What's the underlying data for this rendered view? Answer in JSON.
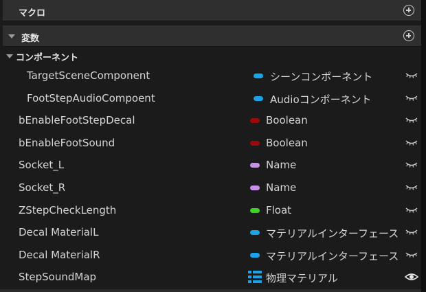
{
  "sections": {
    "macro_label": "マクロ",
    "variables_label": "変数"
  },
  "category": {
    "label": "コンポーネント"
  },
  "colors": {
    "object_blue": "#1aa3e8",
    "boolean_red": "#9b0a0a",
    "name_purple": "#c890ec",
    "float_green": "#3ed320"
  },
  "variables": [
    {
      "name": "TargetSceneComponent",
      "type": "シーンコンポーネント",
      "color": "#1aa3e8",
      "indent": true,
      "visibility": "closed-eye-icon"
    },
    {
      "name": "FootStepAudioCompoent",
      "type": "Audioコンポーネント",
      "color": "#1aa3e8",
      "indent": true,
      "visibility": "closed-eye-icon"
    },
    {
      "name": "bEnableFootStepDecal",
      "type": "Boolean",
      "color": "#9b0a0a",
      "indent": false,
      "visibility": "closed-eye-icon"
    },
    {
      "name": "bEnableFootSound",
      "type": "Boolean",
      "color": "#9b0a0a",
      "indent": false,
      "visibility": "closed-eye-icon"
    },
    {
      "name": "Socket_L",
      "type": "Name",
      "color": "#c890ec",
      "indent": false,
      "visibility": "closed-eye-icon"
    },
    {
      "name": "Socket_R",
      "type": "Name",
      "color": "#c890ec",
      "indent": false,
      "visibility": "closed-eye-icon"
    },
    {
      "name": "ZStepCheckLength",
      "type": "Float",
      "color": "#3ed320",
      "indent": false,
      "visibility": "closed-eye-icon"
    },
    {
      "name": "Decal MaterialL",
      "type": "マテリアルインターフェース",
      "color": "#1aa3e8",
      "indent": false,
      "visibility": "closed-eye-icon"
    },
    {
      "name": "Decal MaterialR",
      "type": "マテリアルインターフェース",
      "color": "#1aa3e8",
      "indent": false,
      "visibility": "closed-eye-icon"
    },
    {
      "name": "StepSoundMap",
      "type": "物理マテリアル",
      "color": "#1aa3e8",
      "indent": false,
      "visibility": "open-eye-icon",
      "container": "map-icon"
    }
  ]
}
